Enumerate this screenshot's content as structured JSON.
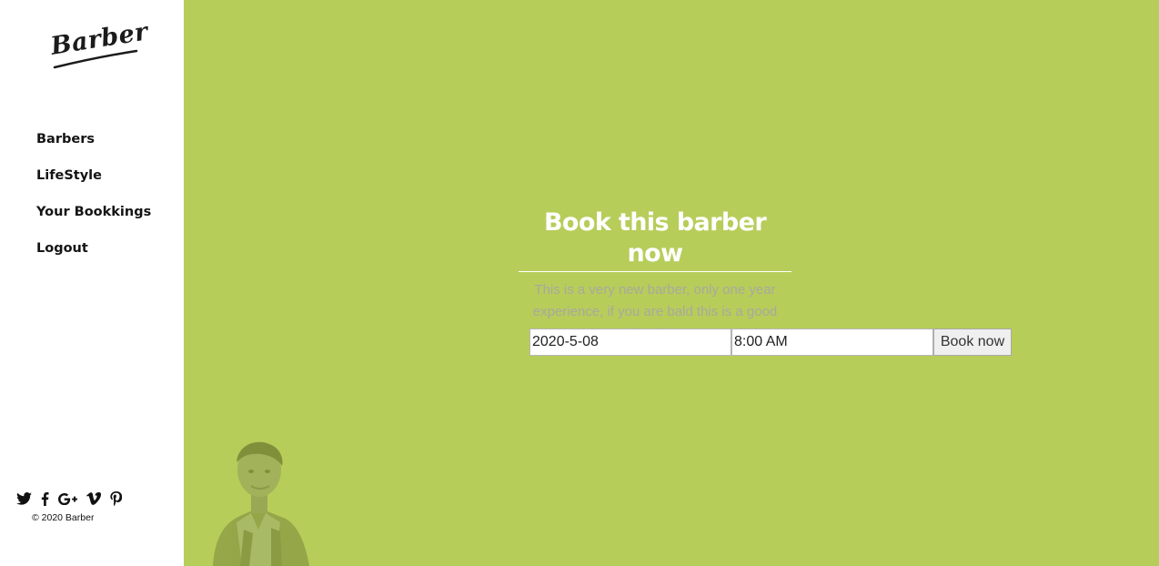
{
  "brand": {
    "logo_text": "Barber"
  },
  "nav": {
    "items": [
      {
        "label": "Barbers"
      },
      {
        "label": "LifeStyle"
      },
      {
        "label": "Your Bookkings"
      },
      {
        "label": "Logout"
      }
    ]
  },
  "social": {
    "icons": [
      "twitter-icon",
      "facebook-icon",
      "google-plus-icon",
      "vimeo-icon",
      "pinterest-icon"
    ]
  },
  "footer": {
    "copyright": "© 2020 Barber"
  },
  "booking": {
    "title": "Book this barber now",
    "description": "This is a very new barber, only one year experience, if you are bald this is a good barber",
    "date_value": "2020-5-08",
    "time_value": "8:00 AM",
    "submit_label": "Book now"
  },
  "colors": {
    "main_background": "#b6cd5a",
    "sidebar_background": "#ffffff",
    "description_text": "#a8a99d"
  }
}
